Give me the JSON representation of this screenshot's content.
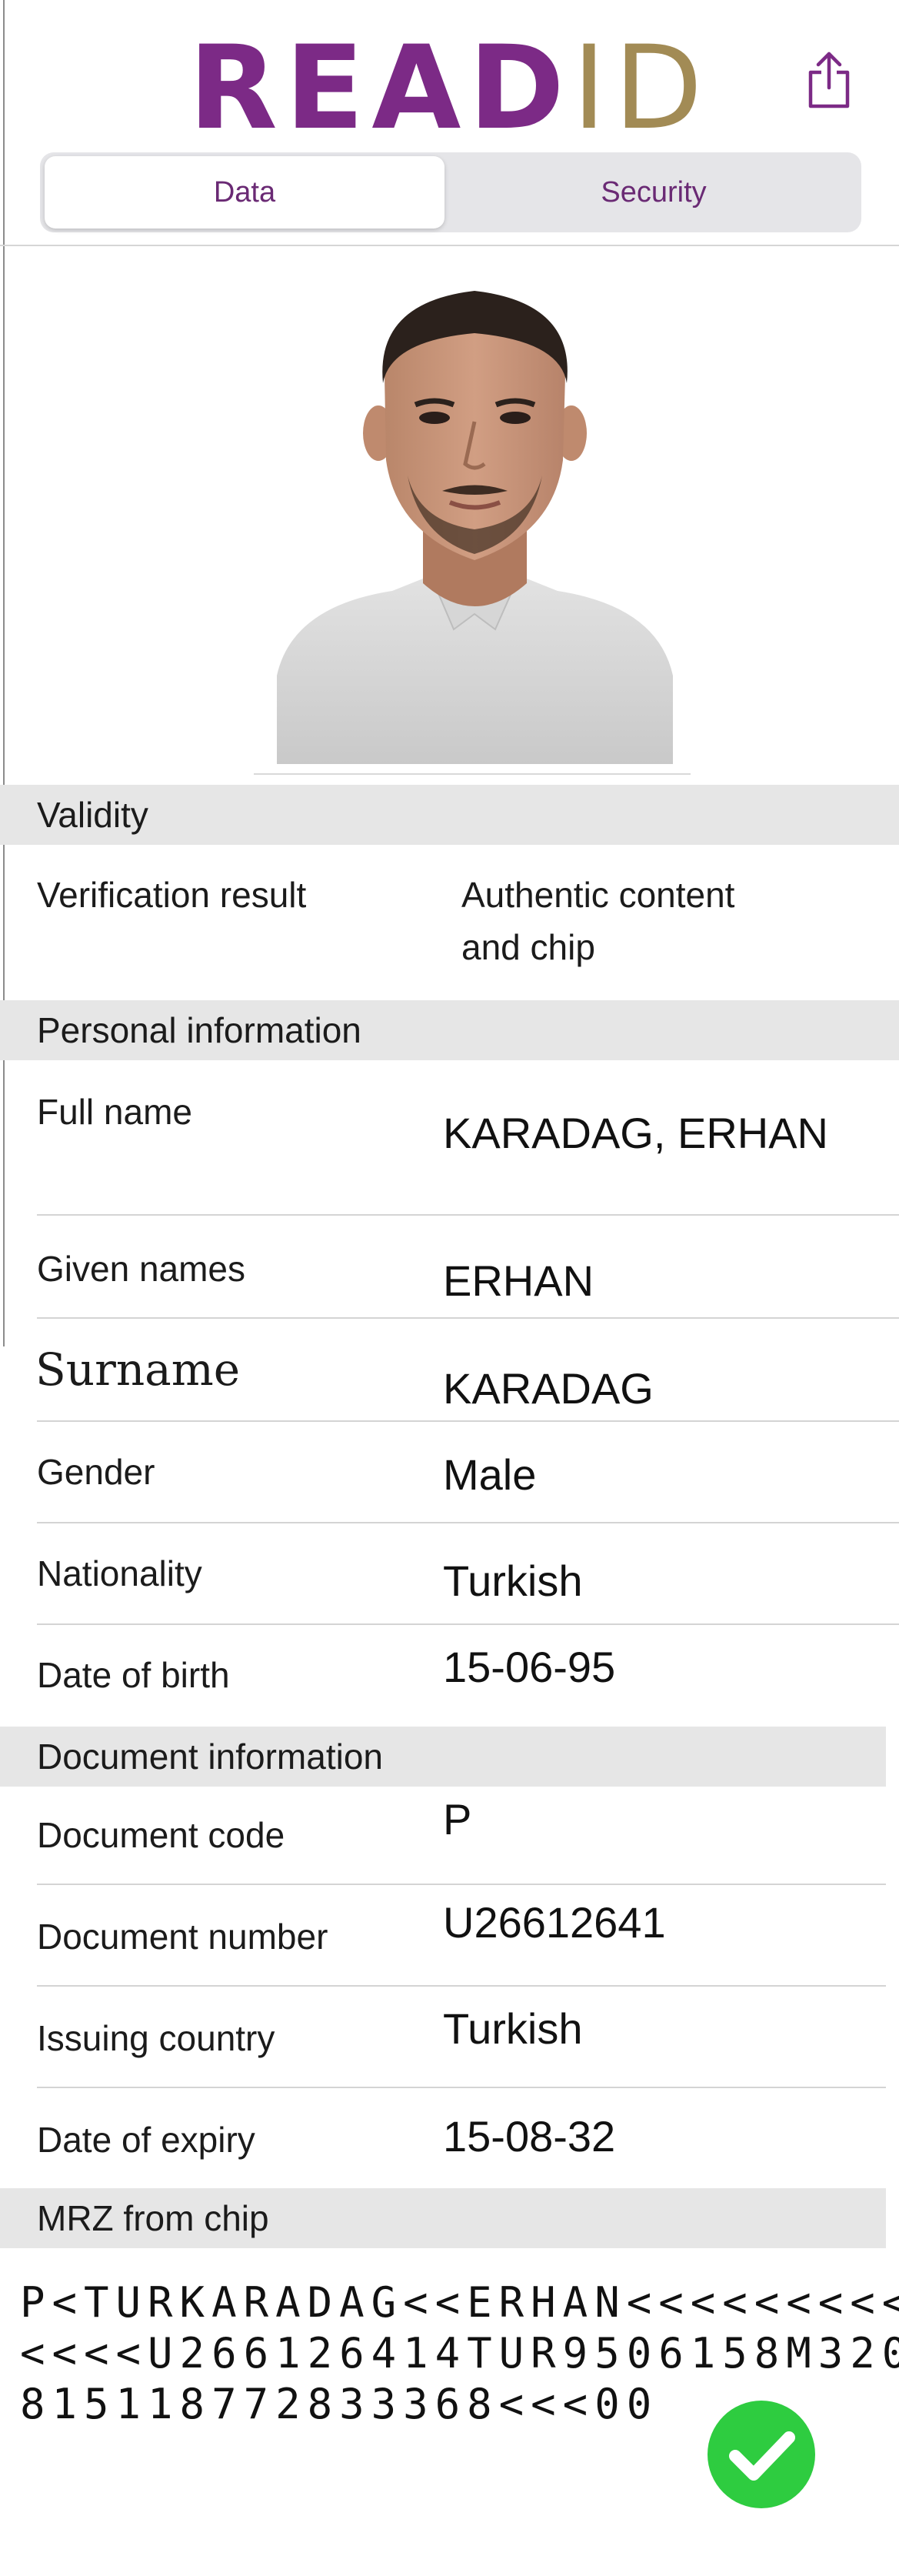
{
  "header": {
    "logo_main": "READ",
    "logo_accent": "ID",
    "tabs": {
      "data": "Data",
      "security": "Security"
    }
  },
  "sections": {
    "validity": "Validity",
    "personal": "Personal information",
    "document": "Document information",
    "mrz": "MRZ from chip"
  },
  "validity": {
    "verification_label": "Verification result",
    "verification_value_line1": "Authentic content",
    "verification_value_line2": "and chip"
  },
  "personal": {
    "full_name_label": "Full name",
    "full_name_value": "KARADAG, ERHAN",
    "given_names_label": "Given names",
    "given_names_value": "ERHAN",
    "surname_label": "Surname",
    "surname_value": "KARADAG",
    "gender_label": "Gender",
    "gender_value": "Male",
    "nationality_label": "Nationality",
    "nationality_value": "Turkish",
    "dob_label": "Date of birth",
    "dob_value": "15-06-95"
  },
  "document": {
    "code_label": "Document code",
    "code_value": "P",
    "number_label": "Document number",
    "number_value": "U26612641",
    "issuing_label": "Issuing country",
    "issuing_value": "Turkish",
    "expiry_label": "Date of expiry",
    "expiry_value": "15-08-32"
  },
  "mrz": {
    "line1": "P<TURKARADAG<<ERHAN<<<<<<<<<",
    "line2": "<<<<U266126414TUR9506158M320",
    "line3": "815118772833368<<<00"
  },
  "colors": {
    "brand_purple": "#7c2a86",
    "brand_gold": "#a28b55",
    "section_bg": "#e6e6e6",
    "check_green": "#2ecc40"
  }
}
